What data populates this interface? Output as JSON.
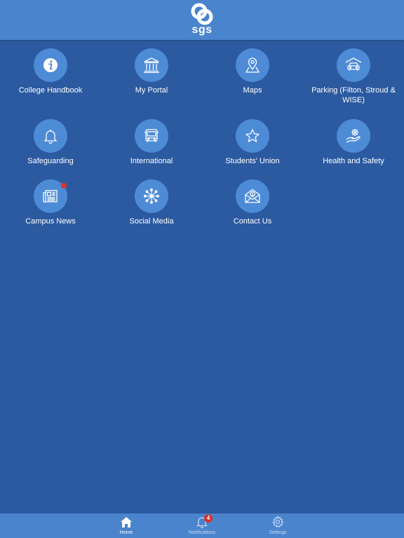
{
  "header": {
    "logo_text": "sgs",
    "logo_icon": "sgs-logo-icon"
  },
  "tiles": [
    {
      "label": "College Handbook",
      "icon": "info-icon",
      "has_dot": false
    },
    {
      "label": "My Portal",
      "icon": "institution-icon",
      "has_dot": false
    },
    {
      "label": "Maps",
      "icon": "map-pin-icon",
      "has_dot": false
    },
    {
      "label": "Parking (Filton, Stroud & WISE)",
      "icon": "car-garage-icon",
      "has_dot": false
    },
    {
      "label": "Safeguarding",
      "icon": "bell-icon",
      "has_dot": false
    },
    {
      "label": "International",
      "icon": "bus-icon",
      "has_dot": false
    },
    {
      "label": "Students' Union",
      "icon": "star-icon",
      "has_dot": false
    },
    {
      "label": "Health and Safety",
      "icon": "hand-gear-icon",
      "has_dot": false
    },
    {
      "label": "Campus News",
      "icon": "newspaper-icon",
      "has_dot": true
    },
    {
      "label": "Social Media",
      "icon": "network-icon",
      "has_dot": false
    },
    {
      "label": "Contact Us",
      "icon": "envelope-icon",
      "has_dot": false
    }
  ],
  "tabbar": {
    "home": {
      "label": "Home",
      "icon": "home-icon",
      "active": true
    },
    "notifications": {
      "label": "Notifications",
      "icon": "bell-icon",
      "badge": "4"
    },
    "settings": {
      "label": "Settings",
      "icon": "gear-icon"
    }
  },
  "colors": {
    "background": "#2b5aa0",
    "header": "#4a84cd",
    "tile_circle": "#4e8bd6",
    "badge": "#e0322b"
  }
}
